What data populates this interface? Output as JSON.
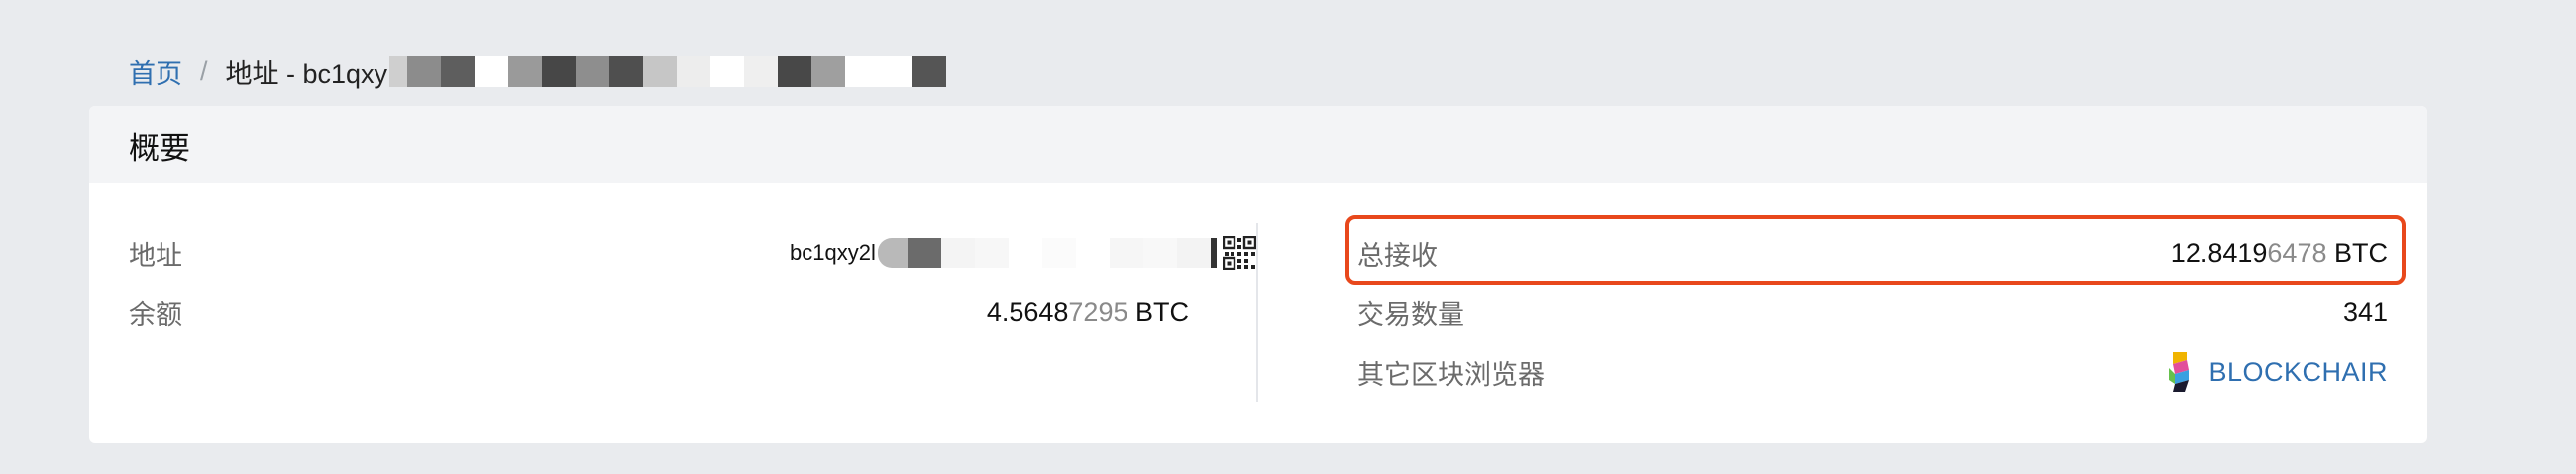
{
  "breadcrumb": {
    "home": "首页",
    "separator": "/",
    "current_prefix": "地址 - bc1qxy"
  },
  "card": {
    "title": "概要",
    "left": {
      "address_label": "地址",
      "address_value_prefix": "bc1qxy2l",
      "balance_label": "余额",
      "balance_main": "4.5648",
      "balance_muted": "7295",
      "balance_unit": "BTC"
    },
    "right": {
      "total_received_label": "总接收",
      "total_received_main": "12.8419",
      "total_received_muted": "6478",
      "total_received_unit": "BTC",
      "tx_count_label": "交易数量",
      "tx_count_value": "341",
      "explorers_label": "其它区块浏览器",
      "explorer_name": "BLOCKCHAIR"
    }
  },
  "colors": {
    "link": "#2f6fb0",
    "highlight": "#e8481c",
    "background": "#e9ebee",
    "header_bg": "#f3f4f6"
  },
  "icons": {
    "qr": "qr-code-icon",
    "explorer": "blockchair-logo-icon"
  }
}
